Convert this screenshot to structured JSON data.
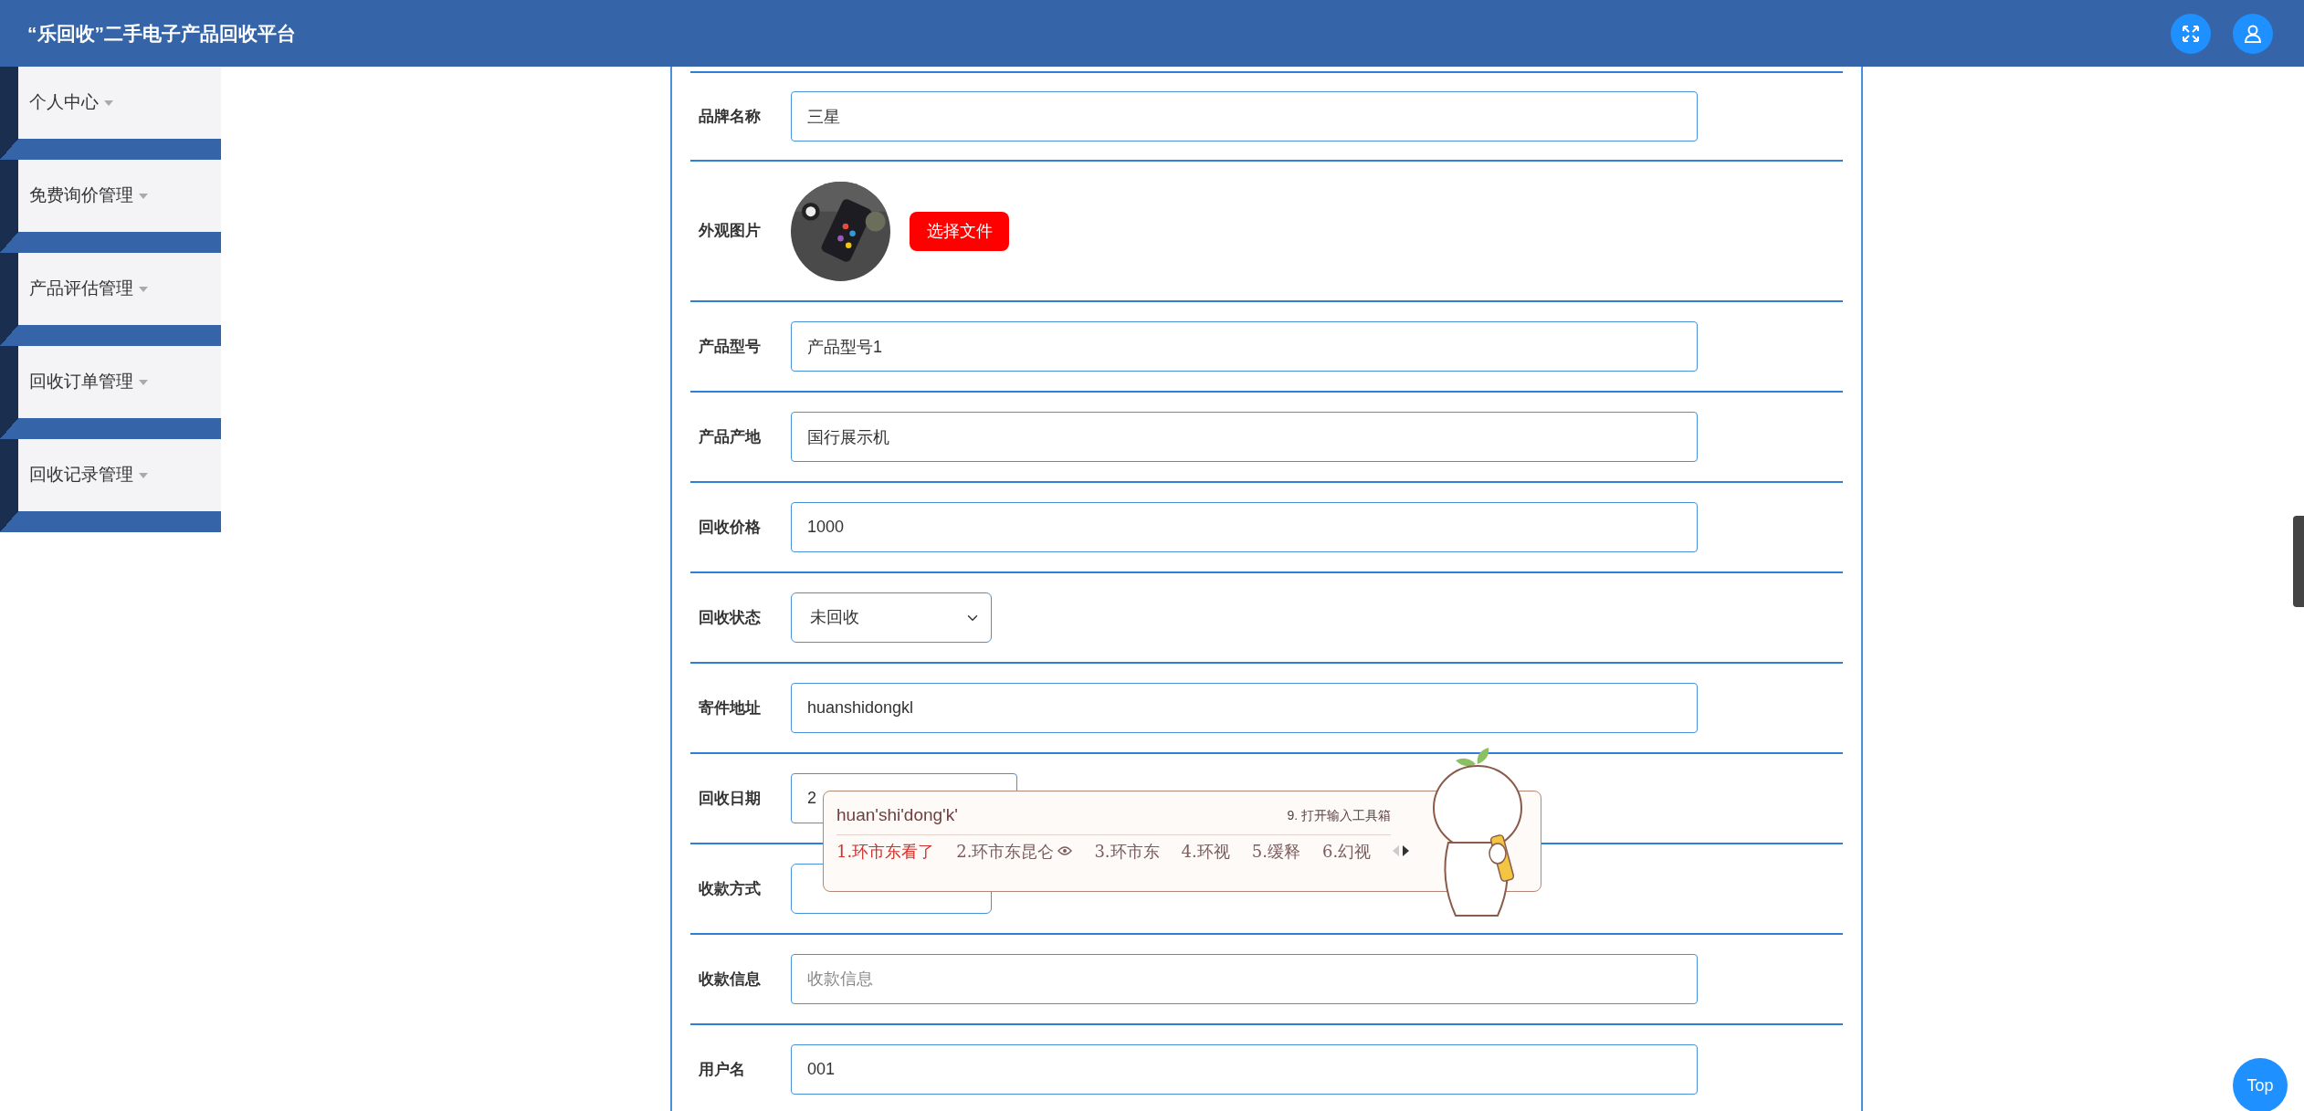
{
  "header": {
    "title": "“乐回收”二手电子产品回收平台"
  },
  "sidebar": {
    "items": [
      {
        "label": "个人中心"
      },
      {
        "label": "免费询价管理"
      },
      {
        "label": "产品评估管理"
      },
      {
        "label": "回收订单管理"
      },
      {
        "label": "回收记录管理"
      }
    ]
  },
  "form": {
    "fields": [
      {
        "kind": "text",
        "label": "品牌名称",
        "value": "三星"
      },
      {
        "label": "外观图片",
        "button": "选择文件"
      },
      {
        "kind": "text",
        "label": "产品型号",
        "value": "产品型号1"
      },
      {
        "kind": "text",
        "label": "产品产地",
        "value": "国行展示机"
      },
      {
        "kind": "text",
        "label": "回收价格",
        "value": "1000"
      },
      {
        "kind": "select",
        "label": "回收状态",
        "value": "未回收"
      },
      {
        "kind": "text",
        "label": "寄件地址",
        "value": "huanshidongkl"
      },
      {
        "kind": "date",
        "label": "回收日期",
        "value": "2"
      },
      {
        "kind": "select",
        "label": "收款方式"
      },
      {
        "kind": "text",
        "label": "收款信息",
        "placeholder": "收款信息"
      },
      {
        "kind": "text",
        "label": "用户名",
        "value": "001"
      }
    ]
  },
  "ime": {
    "composition": "huan'shi'dong'k'",
    "toolbox": "9. 打开输入工具箱",
    "candidates": [
      {
        "text": "1.环市东看了",
        "selected": true,
        "icon": false
      },
      {
        "text": "2.环市东昆仑",
        "selected": false,
        "icon": true
      },
      {
        "text": "3.环市东",
        "selected": false,
        "icon": false
      },
      {
        "text": "4.环视",
        "selected": false,
        "icon": false
      },
      {
        "text": "5.缓释",
        "selected": false,
        "icon": false
      },
      {
        "text": "6.幻视",
        "selected": false,
        "icon": false
      }
    ]
  },
  "top_button": {
    "label": "Top"
  }
}
